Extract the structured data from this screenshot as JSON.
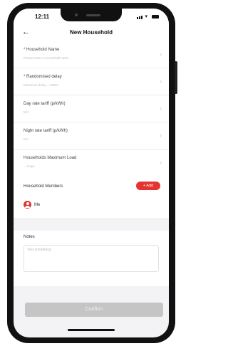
{
  "status": {
    "time": "12:11"
  },
  "nav": {
    "title": "New Household",
    "back_icon": "arrow-left-icon"
  },
  "form": {
    "fields": [
      {
        "label": "* Household Name",
        "placeholder": "Please enter a household name"
      },
      {
        "label": "* Randomised delay",
        "placeholder": "Maximum delay + 1800s"
      },
      {
        "label": "Day rate tariff (p/kWh)",
        "placeholder": "N/A"
      },
      {
        "label": "Night rate tariff (p/kWh)",
        "placeholder": "N/A"
      },
      {
        "label": "Households Maximum Load",
        "placeholder": "-- Amps"
      }
    ]
  },
  "members": {
    "title": "Household Members",
    "add_label": "+ Add",
    "items": [
      {
        "name": "Me"
      }
    ]
  },
  "notes": {
    "title": "Notes",
    "placeholder": "Text something"
  },
  "confirm_label": "Confirm",
  "colors": {
    "accent": "#e3342f",
    "disabled": "#c5c5c5"
  }
}
